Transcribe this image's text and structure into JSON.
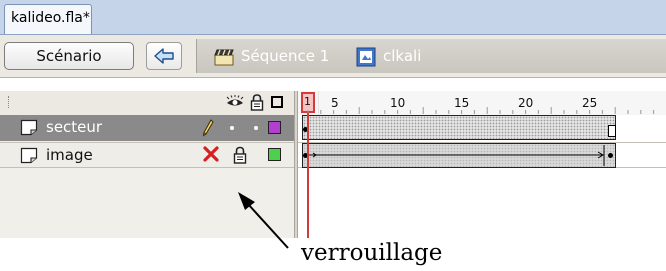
{
  "document_tab": {
    "title": "kalideo.fla*"
  },
  "nav": {
    "scenario_button": "Scénario",
    "back_icon": "arrow-left-icon",
    "sequence_label": "Séquence 1",
    "sequence_icon": "clapperboard-icon",
    "clip_label": "clkali",
    "clip_icon": "movieclip-symbol-icon"
  },
  "layer_header": {
    "icons": [
      "eye-icon",
      "lock-icon",
      "outline-icon"
    ]
  },
  "layers": [
    {
      "name": "secteur",
      "selected": true,
      "status_icon": "pencil-icon",
      "visible_dot": true,
      "locked_dot": true,
      "color": "#b23fcf"
    },
    {
      "name": "image",
      "selected": false,
      "status_icon": "red-x-icon",
      "locked": true,
      "color": "#4dd14d"
    }
  ],
  "ruler": {
    "current_frame": "1",
    "labels": [
      "5",
      "10",
      "15",
      "20",
      "25"
    ]
  },
  "annotation": {
    "text": "verrouillage"
  },
  "colors": {
    "tabbar": "#c5d4e8",
    "toolbar": "#ece9e2",
    "playhead": "#d33a3a",
    "selected_layer": "#8a8a8a"
  }
}
